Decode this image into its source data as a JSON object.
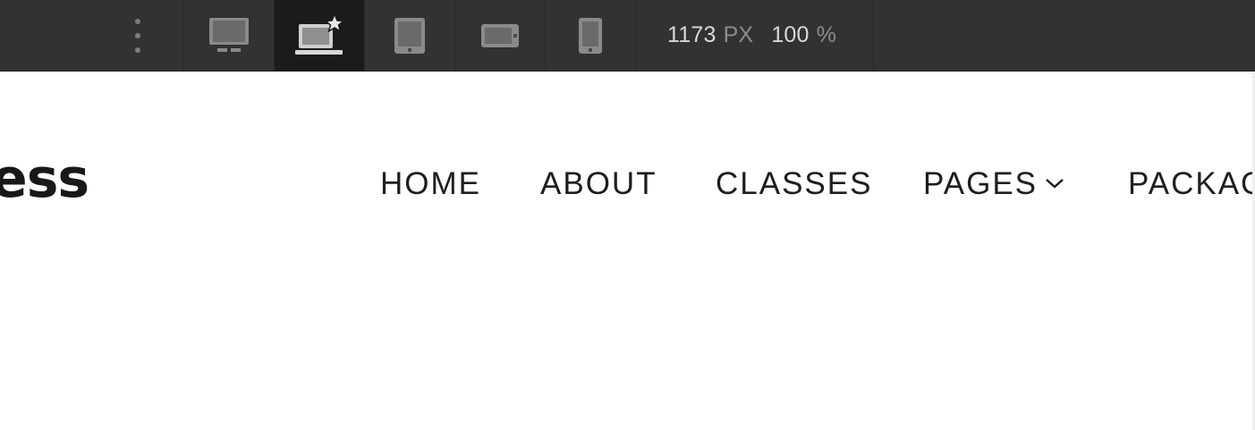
{
  "toolbar": {
    "devices": [
      {
        "name": "desktop",
        "icon": "desktop-monitor-icon",
        "active": false
      },
      {
        "name": "laptop",
        "icon": "laptop-star-icon",
        "active": true
      },
      {
        "name": "tablet-portrait",
        "icon": "tablet-portrait-icon",
        "active": false
      },
      {
        "name": "tablet-landscape",
        "icon": "tablet-landscape-icon",
        "active": false
      },
      {
        "name": "phone",
        "icon": "phone-icon",
        "active": false
      }
    ],
    "width_value": "1173",
    "width_unit": "PX",
    "zoom_value": "100",
    "zoom_unit": "%"
  },
  "site": {
    "logo_text": "ess",
    "nav": {
      "home": "HOME",
      "about": "ABOUT",
      "classes": "CLASSES",
      "pages": "PAGES",
      "packages": "PACKAG"
    }
  },
  "colors": {
    "toolbar_bg": "#323232",
    "toolbar_active": "#1b1b1b",
    "icon_gray": "#8a8a8a",
    "text_dark": "#1e1e1e"
  }
}
